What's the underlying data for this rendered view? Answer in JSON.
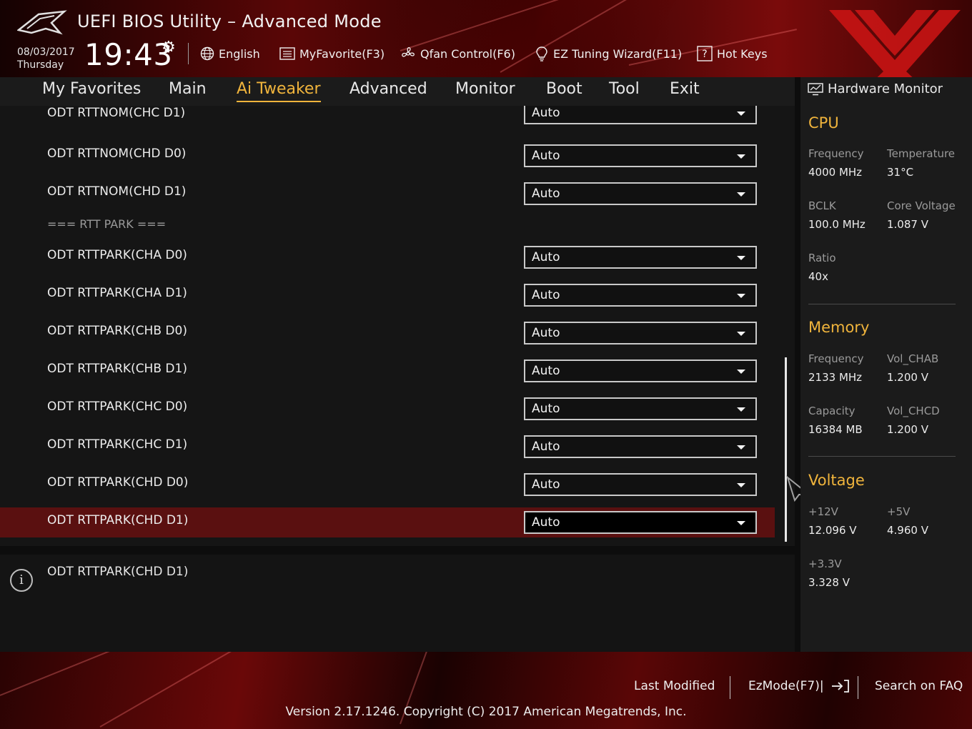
{
  "header": {
    "title": "UEFI BIOS Utility – Advanced Mode",
    "date": "08/03/2017",
    "day": "Thursday",
    "time": "19:43",
    "toolbar": {
      "language": "English",
      "favorite": "MyFavorite(F3)",
      "qfan": "Qfan Control(F6)",
      "ez_tuning": "EZ Tuning Wizard(F11)",
      "hotkeys": "Hot Keys"
    }
  },
  "nav": {
    "tabs": [
      {
        "label": "My Favorites"
      },
      {
        "label": "Main"
      },
      {
        "label": "Ai Tweaker",
        "active": true
      },
      {
        "label": "Advanced"
      },
      {
        "label": "Monitor"
      },
      {
        "label": "Boot"
      },
      {
        "label": "Tool"
      },
      {
        "label": "Exit"
      }
    ]
  },
  "settings": {
    "rows": [
      {
        "label": "ODT RTTNOM(CHC D1)",
        "value": "Auto"
      },
      {
        "label": "ODT RTTNOM(CHD D0)",
        "value": "Auto"
      },
      {
        "label": "ODT RTTNOM(CHD D1)",
        "value": "Auto"
      },
      {
        "label": "ODT RTTPARK(CHA D0)",
        "value": "Auto"
      },
      {
        "label": "ODT RTTPARK(CHA D1)",
        "value": "Auto"
      },
      {
        "label": "ODT RTTPARK(CHB D0)",
        "value": "Auto"
      },
      {
        "label": "ODT RTTPARK(CHB D1)",
        "value": "Auto"
      },
      {
        "label": "ODT RTTPARK(CHC D0)",
        "value": "Auto"
      },
      {
        "label": "ODT RTTPARK(CHC D1)",
        "value": "Auto"
      },
      {
        "label": "ODT RTTPARK(CHD D0)",
        "value": "Auto"
      },
      {
        "label": "ODT RTTPARK(CHD D1)",
        "value": "Auto",
        "selected": true
      }
    ],
    "section_label": "=== RTT PARK ==="
  },
  "info": {
    "text": "ODT RTTPARK(CHD D1)"
  },
  "hardware_monitor": {
    "title": "Hardware Monitor",
    "cpu": {
      "title": "CPU",
      "frequency_label": "Frequency",
      "frequency": "4000 MHz",
      "temperature_label": "Temperature",
      "temperature": "31°C",
      "bclk_label": "BCLK",
      "bclk": "100.0 MHz",
      "core_voltage_label": "Core Voltage",
      "core_voltage": "1.087 V",
      "ratio_label": "Ratio",
      "ratio": "40x"
    },
    "memory": {
      "title": "Memory",
      "frequency_label": "Frequency",
      "frequency": "2133 MHz",
      "vol_chab_label": "Vol_CHAB",
      "vol_chab": "1.200 V",
      "capacity_label": "Capacity",
      "capacity": "16384 MB",
      "vol_chcd_label": "Vol_CHCD",
      "vol_chcd": "1.200 V"
    },
    "voltage": {
      "title": "Voltage",
      "v12_label": "+12V",
      "v12": "12.096 V",
      "v5_label": "+5V",
      "v5": "4.960 V",
      "v33_label": "+3.3V",
      "v33": "3.328 V"
    }
  },
  "footer": {
    "last_modified": "Last Modified",
    "ezmode": "EzMode(F7)|",
    "search_faq": "Search on FAQ",
    "copyright": "Version 2.17.1246. Copyright (C) 2017 American Megatrends, Inc."
  },
  "colors": {
    "accent": "#f0b43c",
    "selected_row": "#5a1010",
    "brand_red": "#c81414"
  }
}
